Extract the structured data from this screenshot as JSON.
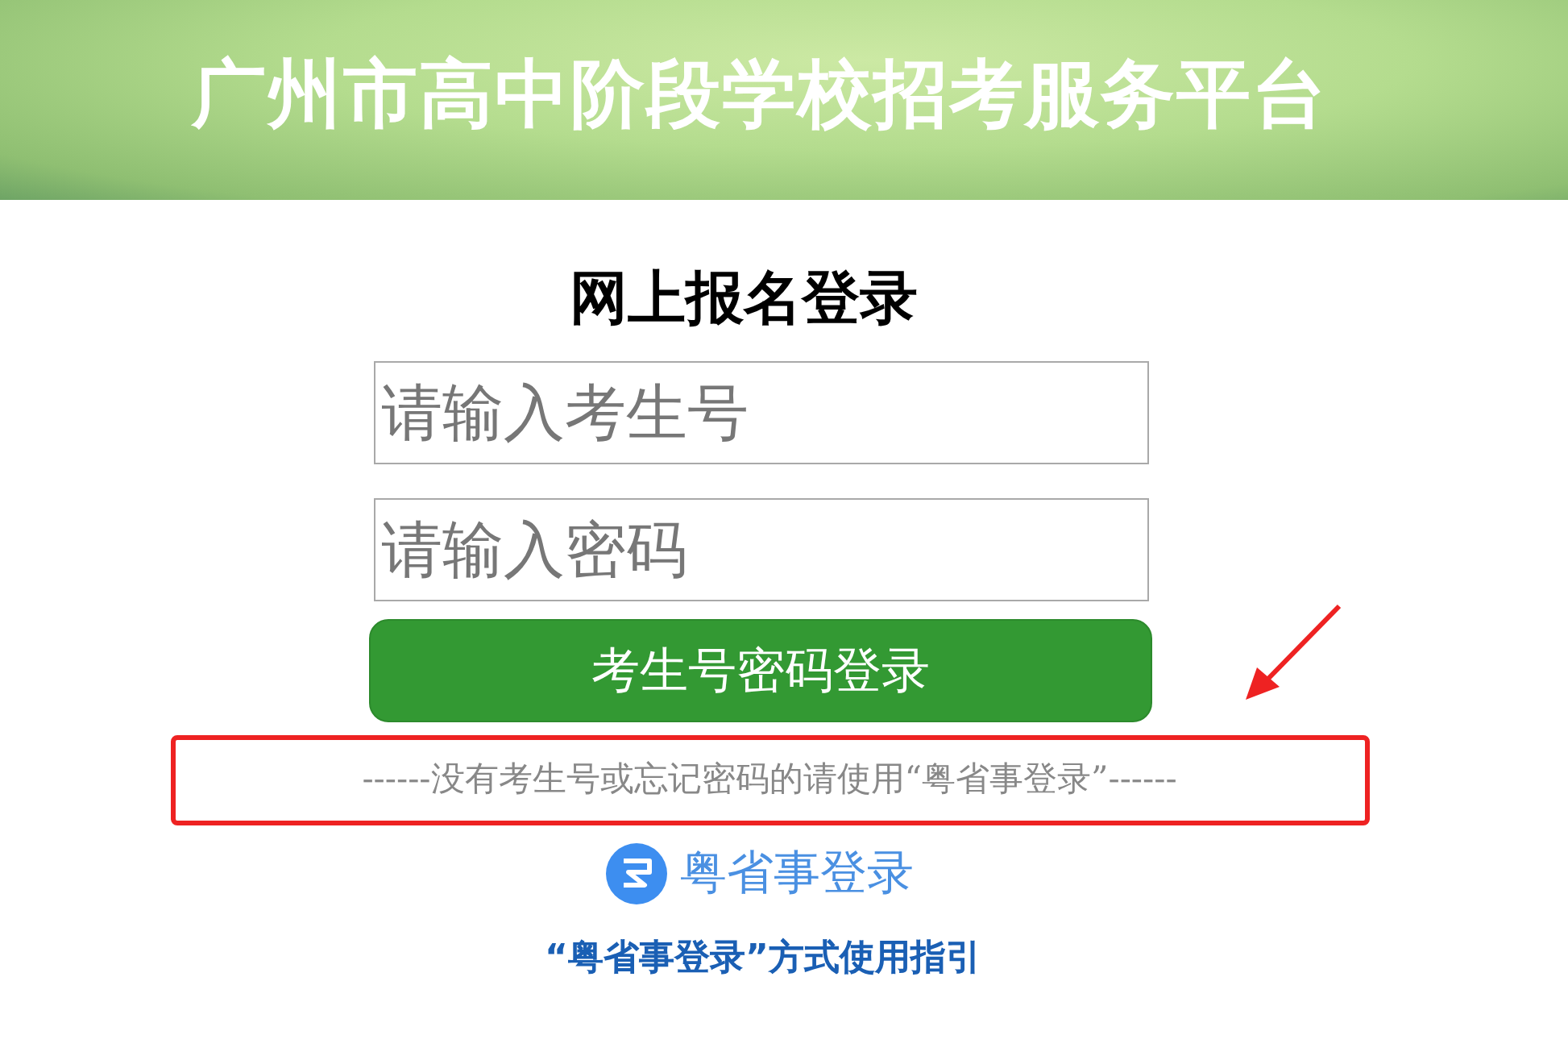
{
  "header": {
    "title": "广州市高中阶段学校招考服务平台"
  },
  "login": {
    "heading": "网上报名登录",
    "fields": [
      {
        "placeholder": "请输入考生号"
      },
      {
        "placeholder": "请输入密码"
      }
    ],
    "submit_button": "考生号密码登录",
    "hint": "------没有考生号或忘记密码的请使用“粤省事登录”------",
    "alt_login_button": "粤省事登录",
    "guide_link": "“粤省事登录”方式使用指引"
  }
}
